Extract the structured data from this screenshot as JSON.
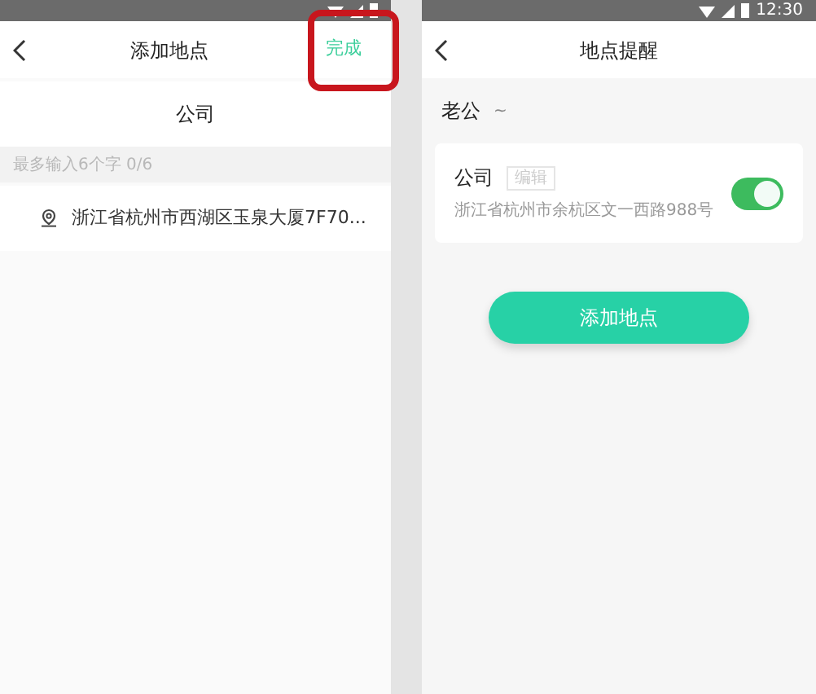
{
  "left_screen": {
    "header": {
      "title": "添加地点",
      "action": "完成",
      "action_highlighted": true
    },
    "name_field": {
      "value": "公司"
    },
    "hint": "最多输入6个字 0/6",
    "address": "浙江省杭州市西湖区玉泉大厦7F70..."
  },
  "right_screen": {
    "status_bar": {
      "time": "12:30"
    },
    "header": {
      "title": "地点提醒"
    },
    "contact": {
      "name": "老公",
      "caret": "~"
    },
    "place_card": {
      "name": "公司",
      "tag": "编辑",
      "address": "浙江省杭州市余杭区文一西路988号",
      "on": true
    },
    "add_button": "添加地点"
  }
}
